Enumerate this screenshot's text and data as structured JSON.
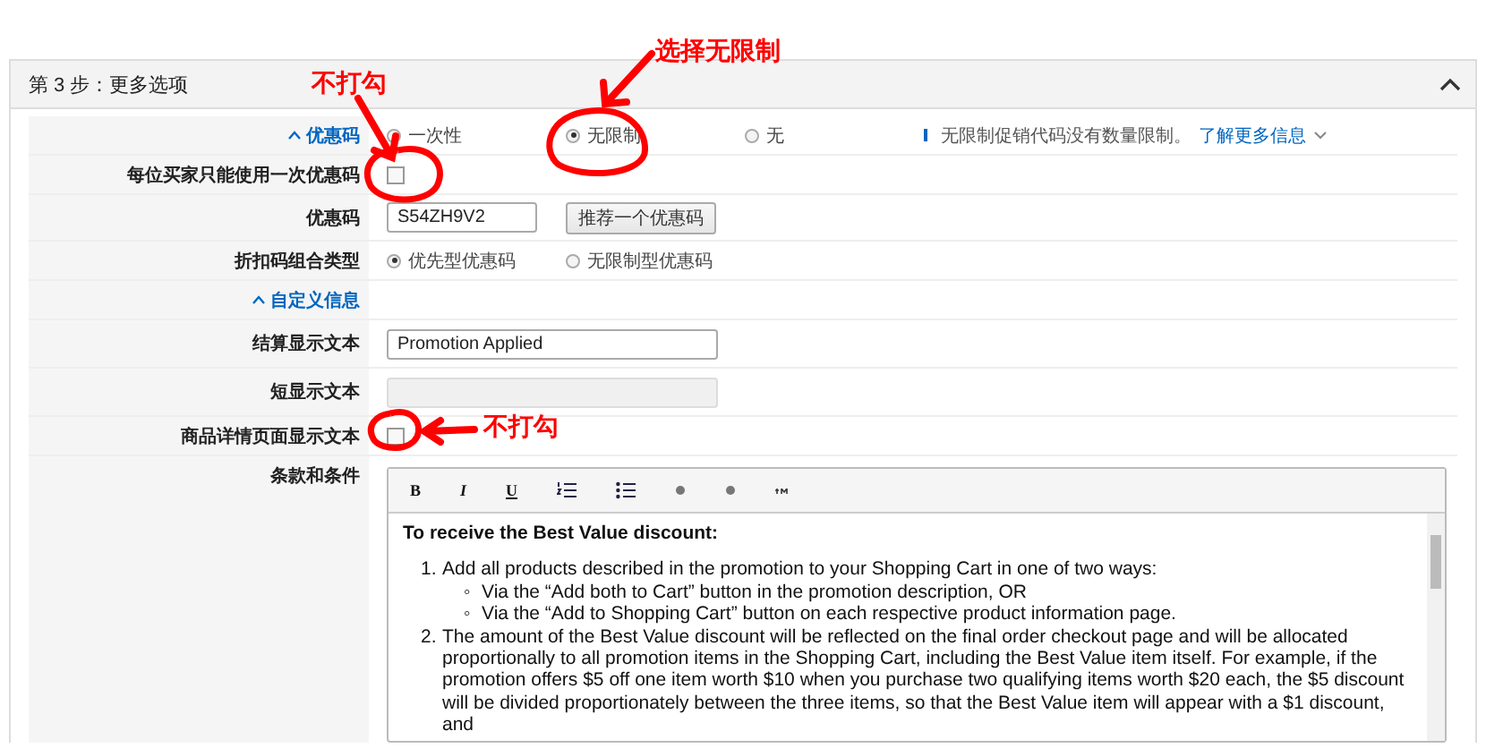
{
  "section": {
    "title": "第 3 步：更多选项",
    "expanded": true
  },
  "rows": [
    {
      "kind": "radio",
      "label": "优惠码",
      "collapsible": true,
      "options": [
        {
          "label": "一次性",
          "selected": false
        },
        {
          "label": "无限制",
          "selected": true
        },
        {
          "label": "无",
          "selected": false
        }
      ],
      "info": {
        "text": "无限制促销代码没有数量限制。",
        "link": "了解更多信息"
      }
    },
    {
      "kind": "checkbox",
      "label": "每位买家只能使用一次优惠码",
      "checked": false
    },
    {
      "kind": "code",
      "label": "优惠码",
      "value": "S54ZH9V2",
      "button": "推荐一个优惠码"
    },
    {
      "kind": "radio",
      "label": "折扣码组合类型",
      "options": [
        {
          "label": "优先型优惠码",
          "selected": true
        },
        {
          "label": "无限制型优惠码",
          "selected": false
        }
      ]
    },
    {
      "kind": "heading",
      "label": "自定义信息",
      "collapsible": true
    },
    {
      "kind": "text",
      "label": "结算显示文本",
      "value": "Promotion Applied",
      "disabled": false
    },
    {
      "kind": "text",
      "label": "短显示文本",
      "disabled": true
    },
    {
      "kind": "checkbox",
      "label": "商品详情页面显示文本",
      "checked": false
    },
    {
      "kind": "editor",
      "label": "条款和条件",
      "toolbar": [
        {
          "kind": "bold",
          "label": "B"
        },
        {
          "kind": "italic",
          "label": "I"
        },
        {
          "kind": "underline",
          "label": "U"
        },
        {
          "kind": "ordered-list"
        },
        {
          "kind": "bullet-list"
        },
        {
          "kind": "dot"
        },
        {
          "kind": "dot"
        },
        {
          "kind": "small"
        }
      ],
      "heading": "To receive the Best Value discount:",
      "items": [
        {
          "marker": "1.",
          "text": "Add all products described in the promotion to your Shopping Cart in one of two ways:",
          "children": [
            {
              "marker": "◦",
              "text": "Via the “Add both to Cart” button in the promotion description, OR"
            },
            {
              "marker": "◦",
              "text": "Via the “Add to Shopping Cart” button on each respective product information page."
            }
          ]
        },
        {
          "marker": "2.",
          "text": "The amount of the Best Value discount will be reflected on the final order checkout page and will be allocated proportionally to all promotion items in the Shopping Cart, including the Best Value item itself. For example, if the promotion offers $5 off one item worth $10 when you purchase two qualifying items worth $20 each, the $5 discount will be divided proportionately between the three items, so that the Best Value item will appear with a $1 discount, and"
        }
      ]
    }
  ],
  "annotations": [
    {
      "text": "不打勾"
    },
    {
      "text": "选择无限制"
    },
    {
      "text": "不打勾"
    }
  ]
}
